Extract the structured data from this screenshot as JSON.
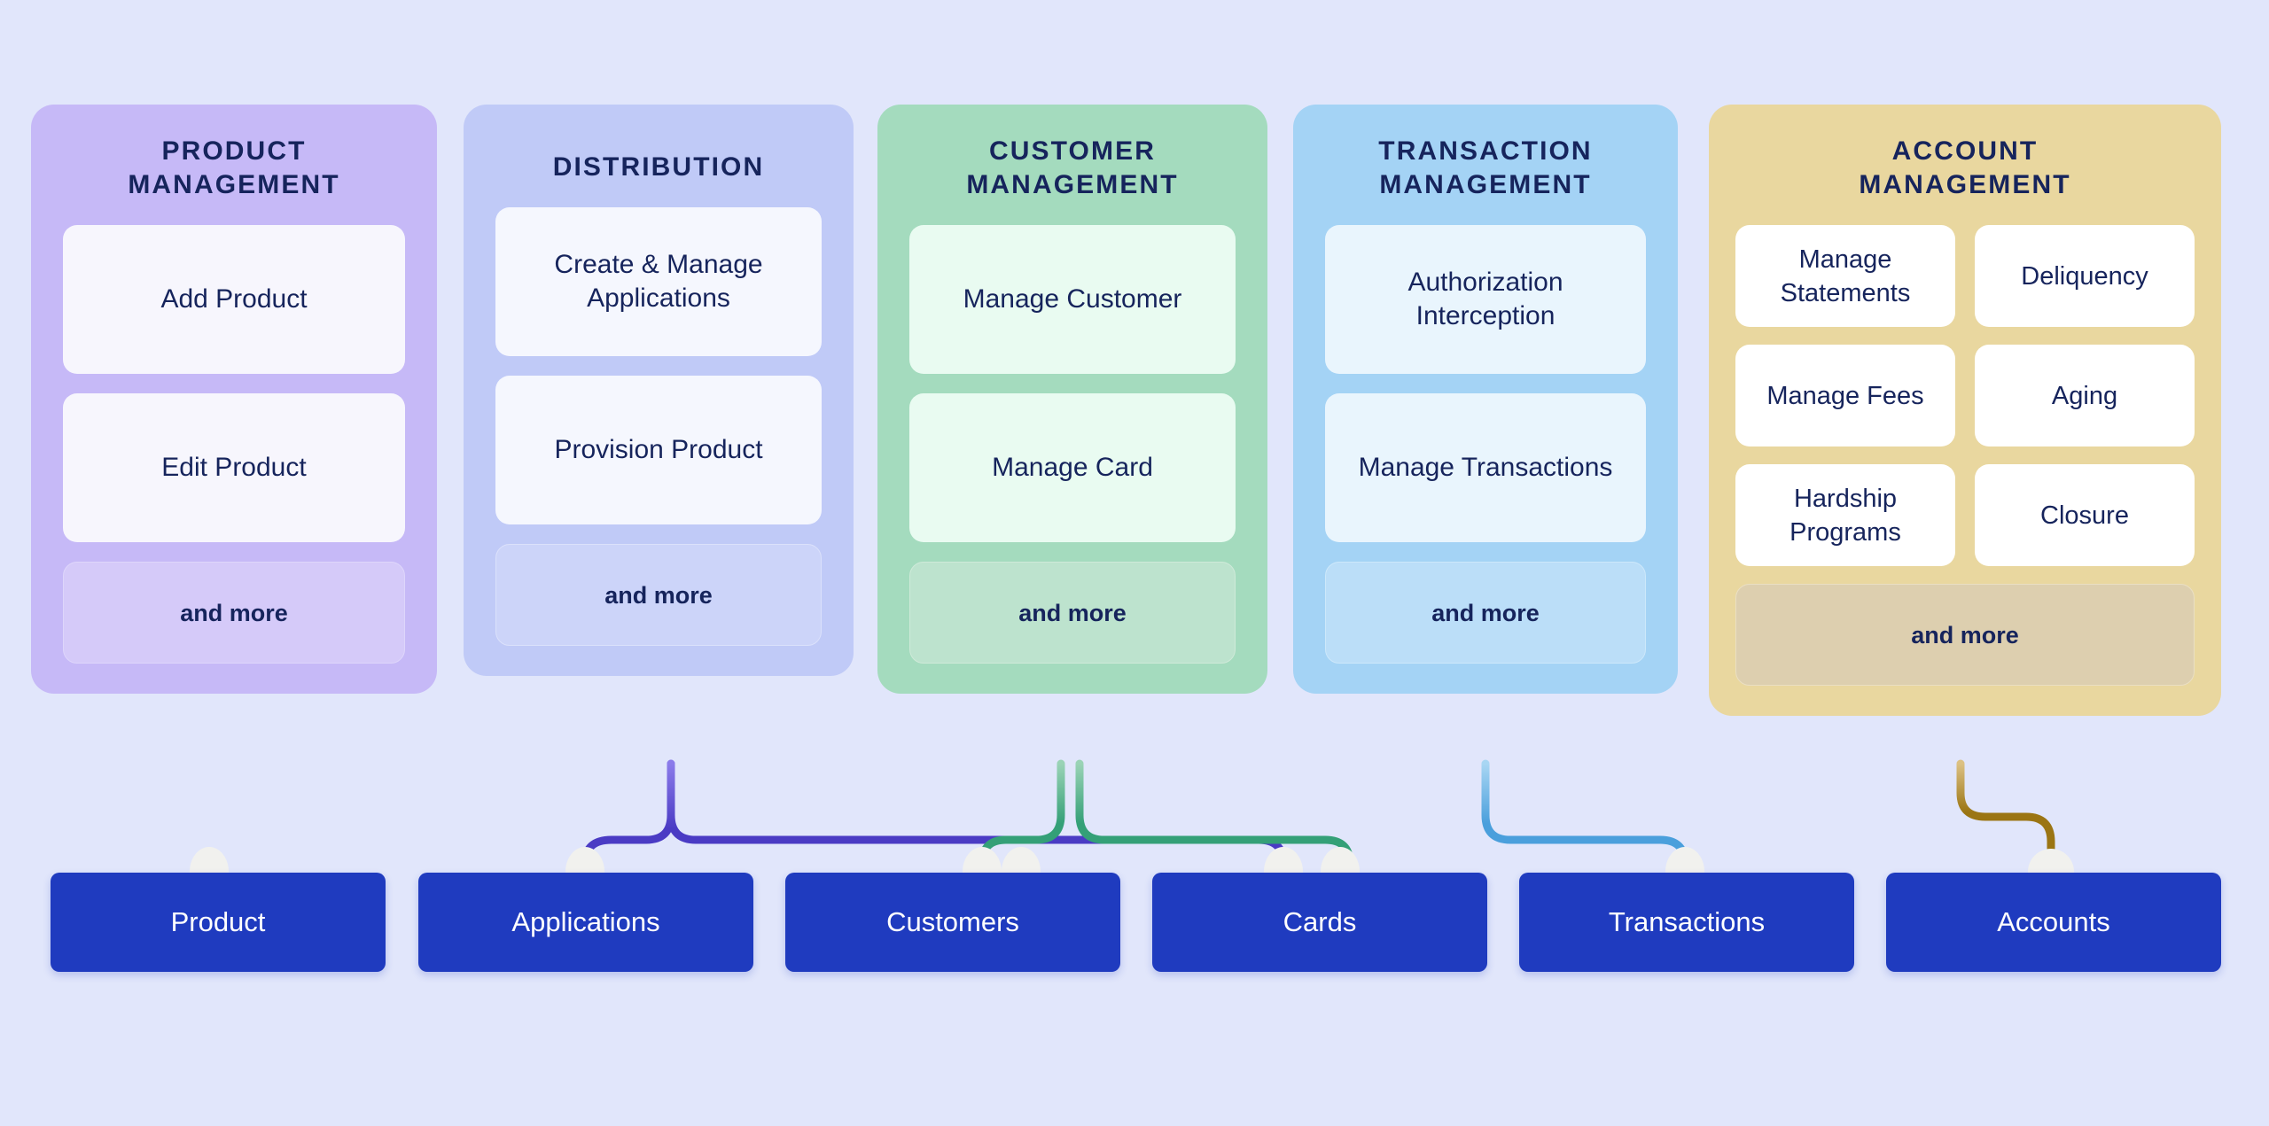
{
  "canvas": {
    "background": "#e1e6fb"
  },
  "columns": [
    {
      "id": "product-management",
      "title": "PRODUCT\nMANAGEMENT",
      "panel_color": "#c6b9f7",
      "card_color": "#f7f6fd",
      "more_color": "#d5caf9",
      "more_border": "#ded6fb",
      "layout": "stack",
      "cards": [
        {
          "label": "Add Product",
          "kind": "tall"
        },
        {
          "label": "Edit Product",
          "kind": "tall"
        },
        {
          "label": "and more",
          "kind": "more"
        }
      ]
    },
    {
      "id": "distribution",
      "title": "DISTRIBUTION",
      "panel_color": "#c0caf7",
      "card_color": "#f5f7fe",
      "more_color": "#ccd4f9",
      "more_border": "#dbe1fb",
      "layout": "stack",
      "cards": [
        {
          "label": "Create & Manage Applications",
          "kind": "tall"
        },
        {
          "label": "Provision Product",
          "kind": "tall"
        },
        {
          "label": "and more",
          "kind": "more"
        }
      ]
    },
    {
      "id": "customer-management",
      "title": "CUSTOMER\nMANAGEMENT",
      "panel_color": "#a4dbbe",
      "card_color": "#e9fbf1",
      "more_color": "#bde3ce",
      "more_border": "#cfead9",
      "layout": "stack",
      "cards": [
        {
          "label": "Manage Customer",
          "kind": "tall"
        },
        {
          "label": "Manage Card",
          "kind": "tall"
        },
        {
          "label": "and more",
          "kind": "more"
        }
      ]
    },
    {
      "id": "transaction-management",
      "title": "TRANSACTION\nMANAGEMENT",
      "panel_color": "#a4d3f5",
      "card_color": "#e9f5fd",
      "more_color": "#bbdef8",
      "more_border": "#cde8fa",
      "layout": "stack",
      "cards": [
        {
          "label": "Authorization Interception",
          "kind": "tall"
        },
        {
          "label": "Manage Transactions",
          "kind": "tall"
        },
        {
          "label": "and more",
          "kind": "more"
        }
      ]
    },
    {
      "id": "account-management",
      "title": "ACCOUNT\nMANAGEMENT",
      "panel_color": "#e9d79f",
      "card_color": "#ffffff",
      "more_color": "#ddcfaf",
      "more_border": "#eadfc3",
      "layout": "grid2",
      "cards": [
        {
          "label": "Manage Statements",
          "kind": "small"
        },
        {
          "label": "Deliquency",
          "kind": "small"
        },
        {
          "label": "Manage Fees",
          "kind": "small"
        },
        {
          "label": "Aging",
          "kind": "small"
        },
        {
          "label": "Hardship Programs",
          "kind": "small"
        },
        {
          "label": "Closure",
          "kind": "small"
        },
        {
          "label": "and more",
          "kind": "more-span2"
        }
      ]
    }
  ],
  "entities": [
    {
      "id": "product",
      "label": "Product"
    },
    {
      "id": "applications",
      "label": "Applications"
    },
    {
      "id": "customers",
      "label": "Customers"
    },
    {
      "id": "cards",
      "label": "Cards"
    },
    {
      "id": "transactions",
      "label": "Transactions"
    },
    {
      "id": "accounts",
      "label": "Accounts"
    }
  ],
  "connectors": {
    "purple": "#4a3bc4",
    "purple_light": "#8b74e8",
    "green": "#34a077",
    "blue": "#4a9fdc",
    "gold": "#9b7513",
    "knob": "#f1f1ee"
  }
}
